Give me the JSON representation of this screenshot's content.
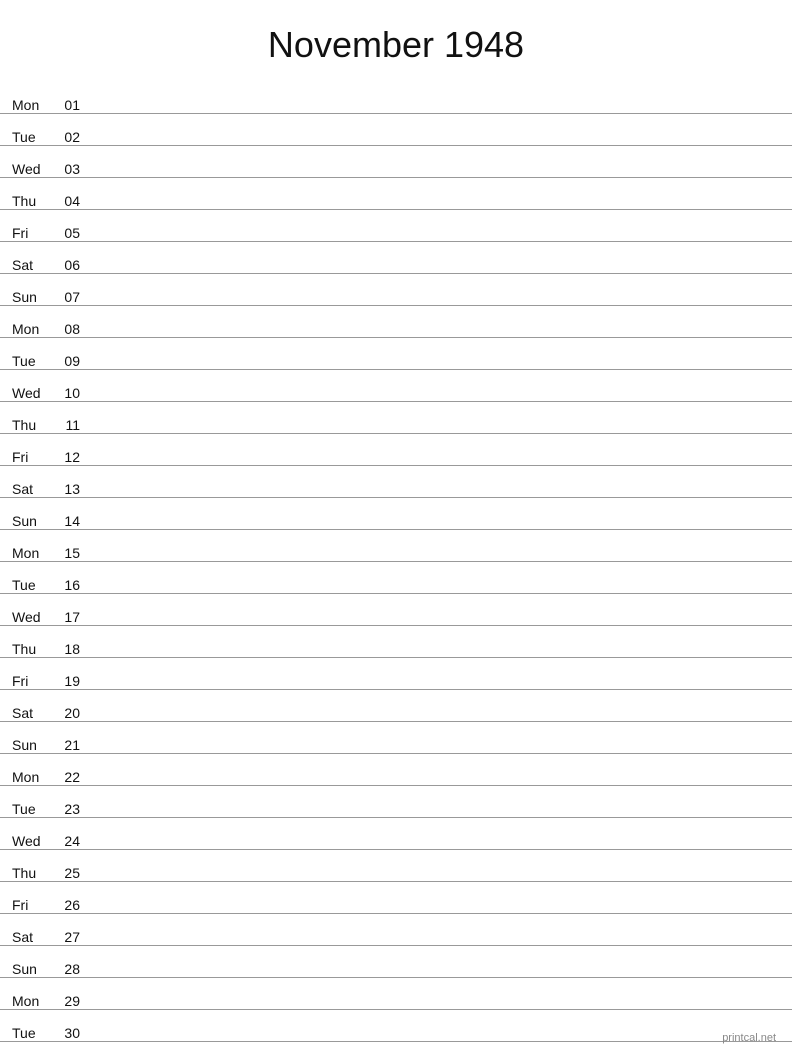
{
  "header": {
    "title": "November 1948"
  },
  "days": [
    {
      "label": "Mon",
      "number": "01"
    },
    {
      "label": "Tue",
      "number": "02"
    },
    {
      "label": "Wed",
      "number": "03"
    },
    {
      "label": "Thu",
      "number": "04"
    },
    {
      "label": "Fri",
      "number": "05"
    },
    {
      "label": "Sat",
      "number": "06"
    },
    {
      "label": "Sun",
      "number": "07"
    },
    {
      "label": "Mon",
      "number": "08"
    },
    {
      "label": "Tue",
      "number": "09"
    },
    {
      "label": "Wed",
      "number": "10"
    },
    {
      "label": "Thu",
      "number": "11"
    },
    {
      "label": "Fri",
      "number": "12"
    },
    {
      "label": "Sat",
      "number": "13"
    },
    {
      "label": "Sun",
      "number": "14"
    },
    {
      "label": "Mon",
      "number": "15"
    },
    {
      "label": "Tue",
      "number": "16"
    },
    {
      "label": "Wed",
      "number": "17"
    },
    {
      "label": "Thu",
      "number": "18"
    },
    {
      "label": "Fri",
      "number": "19"
    },
    {
      "label": "Sat",
      "number": "20"
    },
    {
      "label": "Sun",
      "number": "21"
    },
    {
      "label": "Mon",
      "number": "22"
    },
    {
      "label": "Tue",
      "number": "23"
    },
    {
      "label": "Wed",
      "number": "24"
    },
    {
      "label": "Thu",
      "number": "25"
    },
    {
      "label": "Fri",
      "number": "26"
    },
    {
      "label": "Sat",
      "number": "27"
    },
    {
      "label": "Sun",
      "number": "28"
    },
    {
      "label": "Mon",
      "number": "29"
    },
    {
      "label": "Tue",
      "number": "30"
    }
  ],
  "footer": {
    "text": "printcal.net"
  }
}
